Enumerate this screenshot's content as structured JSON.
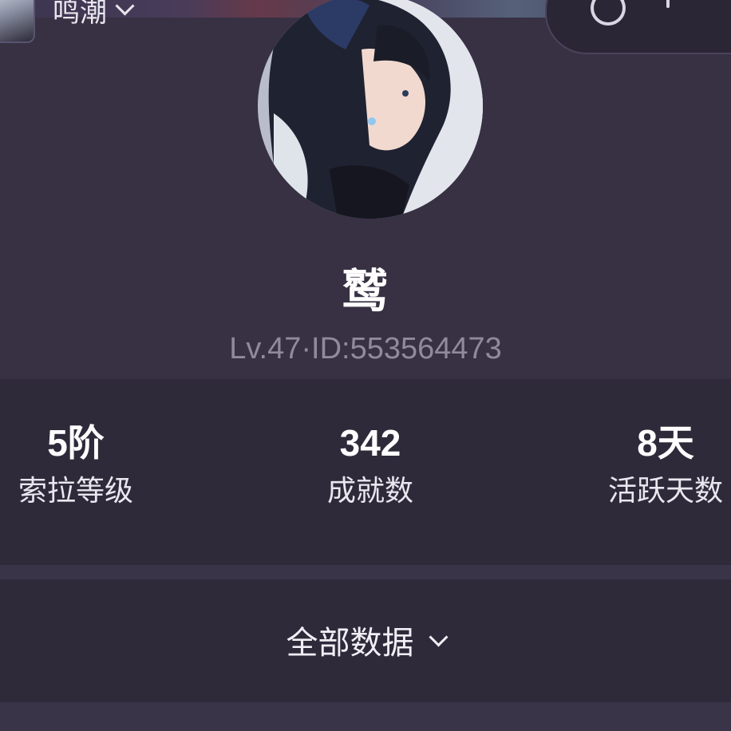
{
  "header": {
    "game_name": "鸣潮",
    "game_icon": "game-thumbnail",
    "actions": [
      "share-icon",
      "more-icon",
      "close-icon"
    ]
  },
  "profile": {
    "username": "鹫",
    "level_id": "Lv.47·ID:553564473"
  },
  "stats": [
    {
      "value": "5阶",
      "label": "索拉等级"
    },
    {
      "value": "342",
      "label": "成就数"
    },
    {
      "value": "8天",
      "label": "活跃天数"
    }
  ],
  "all_data": {
    "label": "全部数据"
  },
  "colors": {
    "background": "#373143",
    "panel": "#2f2a3a",
    "text_primary": "#ffffff",
    "text_secondary": "#8f8a9c"
  }
}
